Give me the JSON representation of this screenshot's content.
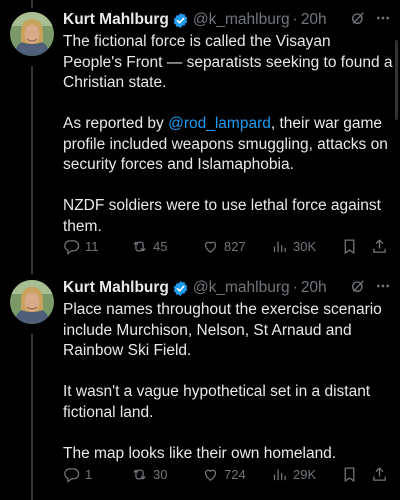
{
  "colors": {
    "background": "#000000",
    "text": "#e7e9ea",
    "muted": "#71767b",
    "link": "#1d9bf0",
    "verified": "#1d9bf0"
  },
  "tweets": [
    {
      "author": {
        "name": "Kurt Mahlburg",
        "handle": "@k_mahlburg",
        "verified_icon": "verified-badge-icon"
      },
      "separator": "·",
      "time": "20h",
      "paragraphs": [
        "The fictional force is called the Visayan People's Front — separatists seeking to found a Christian state.",
        {
          "before": "As reported by ",
          "mention": "@rod_lampard",
          "after": ", their war game profile included weapons smuggling, attacks on security forces and Islamaphobia."
        },
        "NZDF soldiers were to use lethal force against them."
      ],
      "actions": {
        "replies": "11",
        "reposts": "45",
        "likes": "827",
        "views": "30K"
      }
    },
    {
      "author": {
        "name": "Kurt Mahlburg",
        "handle": "@k_mahlburg",
        "verified_icon": "verified-badge-icon"
      },
      "separator": "·",
      "time": "20h",
      "paragraphs": [
        "Place names throughout the exercise scenario include Murchison, Nelson, St Arnaud and Rainbow Ski Field.",
        "It wasn't a vague hypothetical set in a distant fictional land.",
        "The map looks like their own homeland."
      ],
      "actions": {
        "replies": "1",
        "reposts": "30",
        "likes": "724",
        "views": "29K"
      }
    }
  ]
}
